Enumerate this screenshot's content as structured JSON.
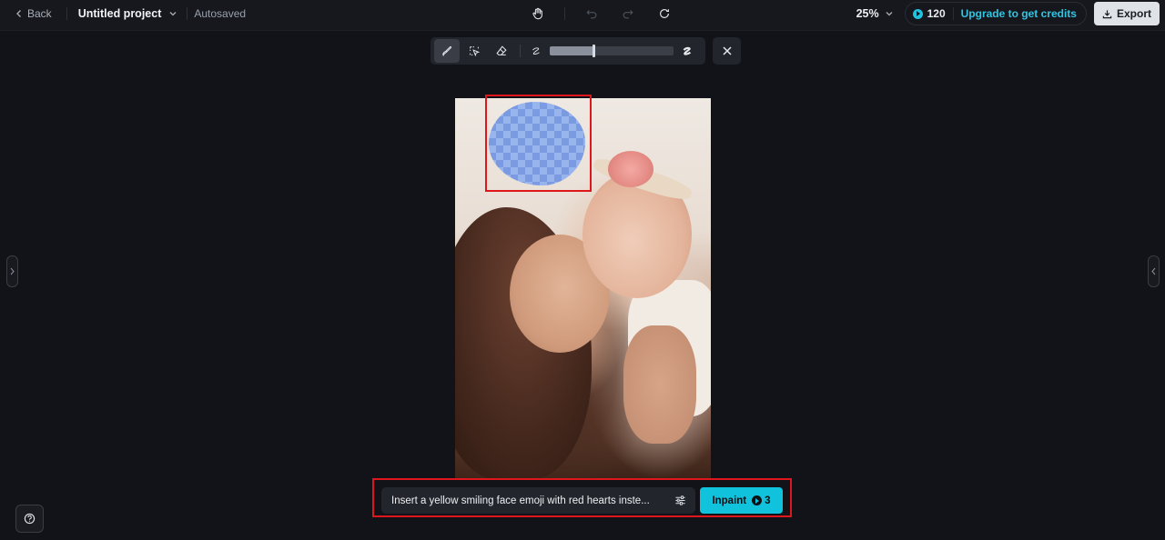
{
  "topbar": {
    "back_label": "Back",
    "project_title": "Untitled project",
    "save_status": "Autosaved",
    "zoom_level": "25%",
    "credits": "120",
    "upgrade_label": "Upgrade to get credits",
    "export_label": "Export"
  },
  "center_tools": [
    "hand-icon",
    "undo-icon",
    "redo-icon",
    "refresh-icon"
  ],
  "mask_toolbar": {
    "tools": [
      "brush-icon",
      "lasso-select-icon",
      "eraser-icon"
    ],
    "brush_size_fraction": 0.35
  },
  "prompt": {
    "text": "Insert a yellow smiling face emoji with red hearts inste...",
    "action_label": "Inpaint",
    "action_cost": "3"
  },
  "colors": {
    "accent": "#11c2dd",
    "highlight": "#e0161d",
    "mask": "#8fb0f0"
  }
}
